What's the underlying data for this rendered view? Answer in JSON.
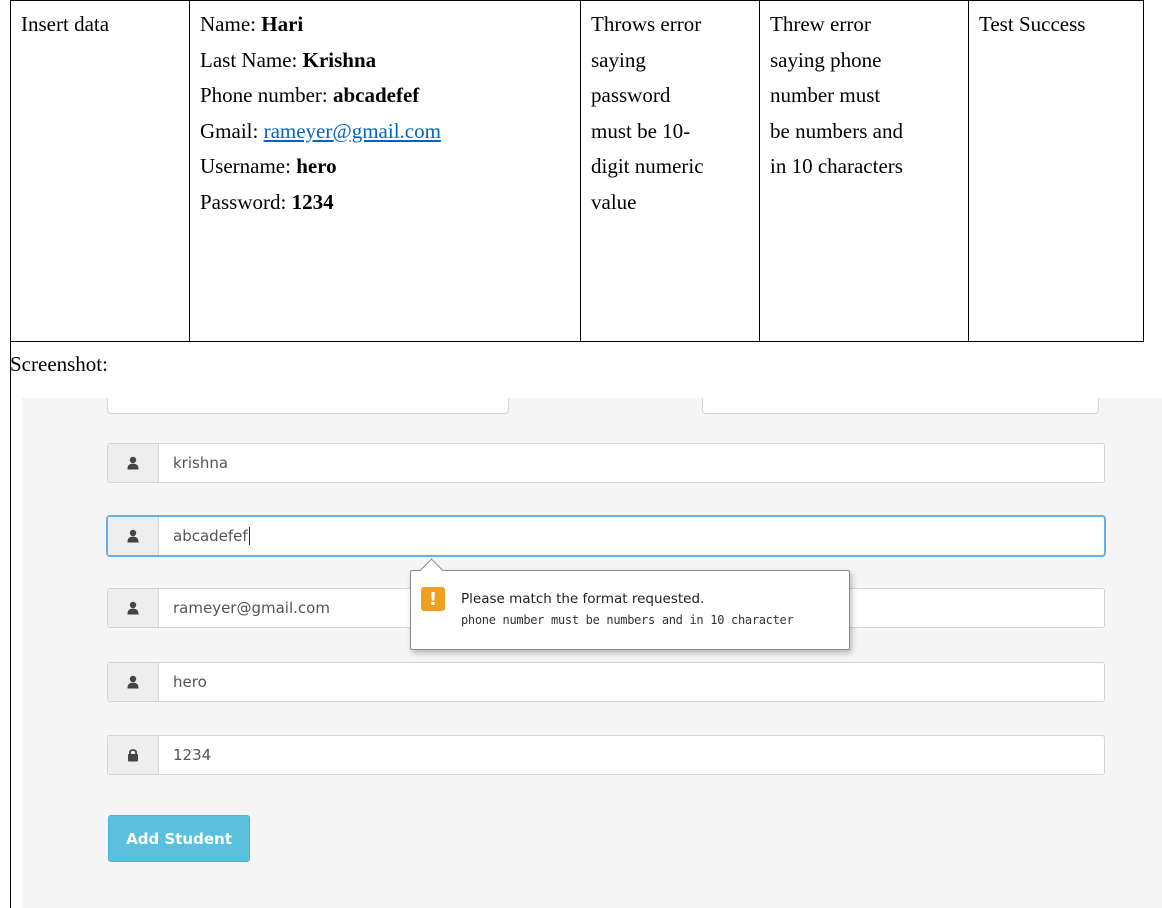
{
  "table": {
    "action": "Insert data",
    "fields": [
      {
        "label": "Name: ",
        "value": "Hari",
        "link": false
      },
      {
        "label": "Last Name: ",
        "value": "Krishna",
        "link": false
      },
      {
        "label": "Phone number: ",
        "value": "abcadefef",
        "link": false
      },
      {
        "label": "Gmail: ",
        "value": "rameyer@gmail.com",
        "link": true
      },
      {
        "label": "Username: ",
        "value": "hero",
        "link": false
      },
      {
        "label": "Password: ",
        "value": "1234",
        "link": false
      }
    ],
    "expected": [
      "Throws error",
      "saying",
      "password",
      "must be 10-",
      "digit numeric",
      "value"
    ],
    "actual": [
      "Threw error",
      "saying phone",
      "number must",
      "be numbers and",
      "in 10 characters"
    ],
    "result": "Test Success",
    "screenshot_label": "Screenshot:"
  },
  "form": {
    "inputs": [
      {
        "icon": "user-icon",
        "value": "krishna"
      },
      {
        "icon": "user-icon",
        "value": "abcadefef"
      },
      {
        "icon": "user-icon",
        "value": "rameyer@gmail.com"
      },
      {
        "icon": "user-icon",
        "value": "hero"
      },
      {
        "icon": "lock-icon",
        "value": "1234"
      }
    ],
    "button_label": "Add Student",
    "tooltip": {
      "title": "Please match the format requested.",
      "message": "phone number must be numbers and in 10 character",
      "icon": "warning-icon"
    }
  }
}
